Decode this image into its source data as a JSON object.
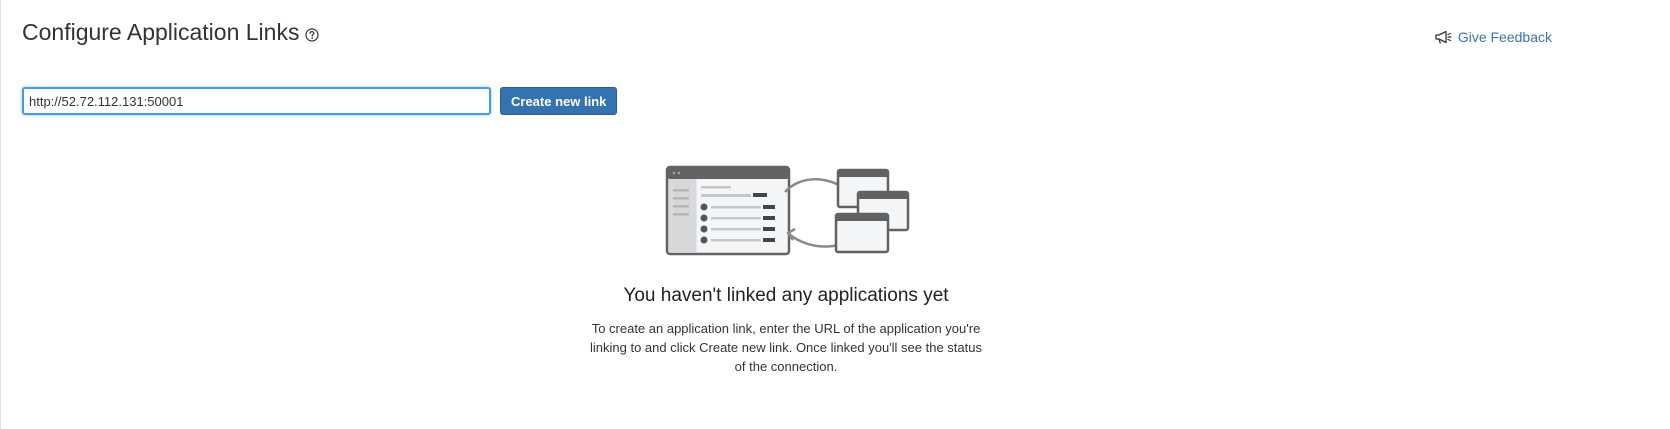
{
  "header": {
    "title": "Configure Application Links",
    "help_icon": "question-circle-icon",
    "feedback_label": "Give Feedback",
    "feedback_icon": "megaphone-icon"
  },
  "form": {
    "url_value": "http://52.72.112.131:50001",
    "create_button_label": "Create new link"
  },
  "empty_state": {
    "illustration": "application-links-illustration",
    "heading": "You haven't linked any applications yet",
    "description": "To create an application link, enter the URL of the application you're linking to and click Create new link. Once linked you'll see the status of the connection."
  },
  "colors": {
    "accent": "#3572b0",
    "link": "#3b73af",
    "input_focus": "#4a9ae1"
  }
}
